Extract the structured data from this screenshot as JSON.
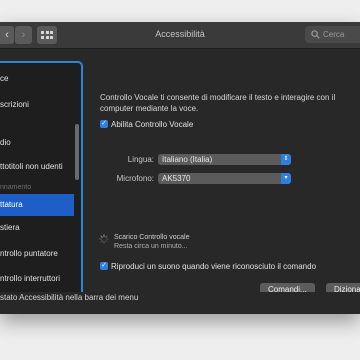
{
  "window": {
    "title": "Accessibilità"
  },
  "toolbar": {
    "back_glyph": "‹",
    "forward_glyph": "›",
    "search_placeholder": "Cerca"
  },
  "sidebar": {
    "items": [
      {
        "label": "ce"
      },
      {
        "label": "scrizioni"
      },
      {
        "label": "dio"
      },
      {
        "label": "ttotitoli non udenti"
      },
      {
        "label": "nnamento",
        "section": true
      },
      {
        "label": "ttatura",
        "selected": true
      },
      {
        "label": "stiera"
      },
      {
        "label": "ntrollo puntatore"
      },
      {
        "label": "ntrollo interruttori"
      }
    ]
  },
  "main": {
    "description": "Controllo Vocale ti consente di modificare il testo e interagire con il computer mediante la voce.",
    "enable_checkbox": {
      "label": "Abilita Controllo Vocale",
      "checked": true
    },
    "language": {
      "label": "Lingua:",
      "value": "Italiano (Italia)"
    },
    "microphone": {
      "label": "Microfono:",
      "value": "AK5370"
    },
    "download": {
      "title": "Scarico Controllo vocale",
      "subtitle": "Resta circa un minuto..."
    },
    "sound_checkbox": {
      "label": "Riproduci un suono quando viene riconosciuto il comando",
      "checked": true
    },
    "commands_button": "Comandi...",
    "vocabulary_button": "Dizionario..."
  },
  "footer": {
    "status_label": "stato Accessibilità nella barra dei menu"
  },
  "colors": {
    "accent": "#2f7fe0",
    "selection": "#1d5fc6",
    "focus_ring": "#2d86d8",
    "window_bg": "#282828"
  }
}
